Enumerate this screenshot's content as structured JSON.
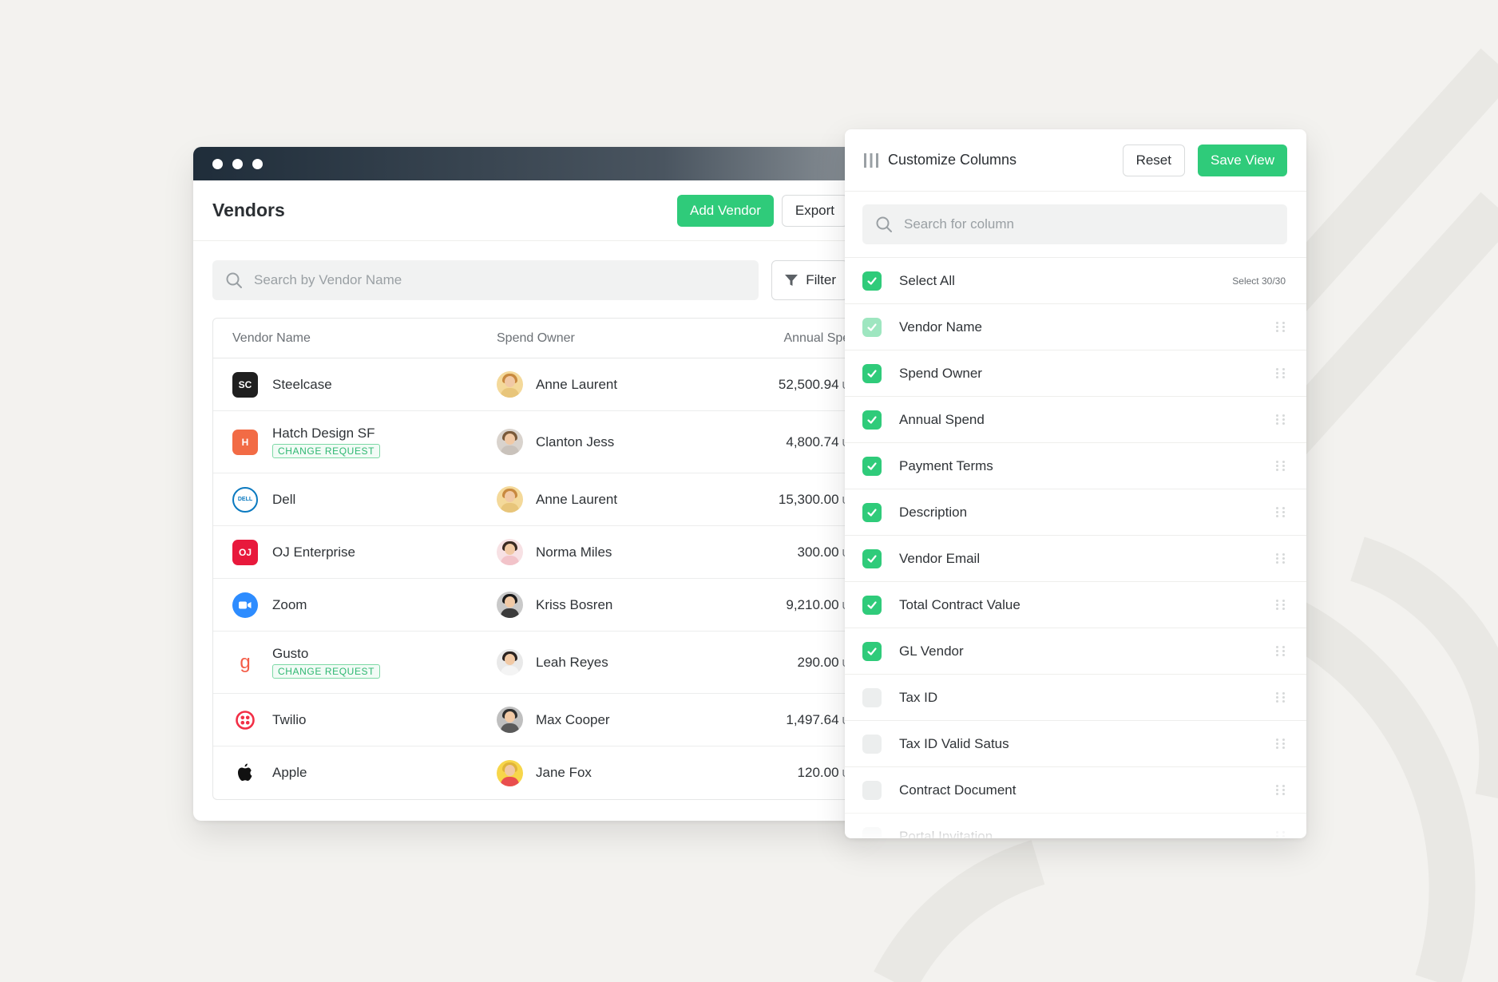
{
  "window": {
    "title": "Vendors",
    "add_vendor_label": "Add Vendor",
    "export_label": "Export",
    "search_placeholder": "Search by Vendor Name",
    "filter_label": "Filter"
  },
  "table": {
    "columns": [
      "Vendor Name",
      "Spend Owner",
      "Annual Spend"
    ],
    "rows": [
      {
        "vendor": "Steelcase",
        "logo_text": "SC",
        "logo_color": "#1f1f1f",
        "badge": "",
        "owner": "Anne Laurent",
        "amount": "52,500.94",
        "currency": "USD"
      },
      {
        "vendor": "Hatch Design SF",
        "logo_text": "H",
        "logo_color": "#f26b45",
        "badge": "CHANGE REQUEST",
        "owner": "Clanton Jess",
        "amount": "4,800.74",
        "currency": "USD"
      },
      {
        "vendor": "Dell",
        "logo_text": "DELL",
        "logo_color": "#0b7ac0",
        "badge": "",
        "owner": "Anne Laurent",
        "amount": "15,300.00",
        "currency": "USD"
      },
      {
        "vendor": "OJ Enterprise",
        "logo_text": "OJ",
        "logo_color": "#e8193c",
        "badge": "",
        "owner": "Norma Miles",
        "amount": "300.00",
        "currency": "USD"
      },
      {
        "vendor": "Zoom",
        "logo_text": "",
        "logo_color": "#2d8cff",
        "badge": "",
        "owner": "Kriss Bosren",
        "amount": "9,210.00",
        "currency": "USD"
      },
      {
        "vendor": "Gusto",
        "logo_text": "g",
        "logo_color": "#f45d48",
        "badge": "CHANGE REQUEST",
        "owner": "Leah Reyes",
        "amount": "290.00",
        "currency": "USD"
      },
      {
        "vendor": "Twilio",
        "logo_text": "",
        "logo_color": "#f22f46",
        "badge": "",
        "owner": "Max Cooper",
        "amount": "1,497.64",
        "currency": "USD"
      },
      {
        "vendor": "Apple",
        "logo_text": "",
        "logo_color": "#111111",
        "badge": "",
        "owner": "Jane Fox",
        "amount": "120.00",
        "currency": "USD"
      }
    ]
  },
  "panel": {
    "title": "Customize Columns",
    "reset_label": "Reset",
    "save_label": "Save View",
    "search_placeholder": "Search for column",
    "select_all_label": "Select All",
    "select_count": "Select 30/30",
    "columns": [
      {
        "label": "Vendor Name",
        "state": "light"
      },
      {
        "label": "Spend Owner",
        "state": "on"
      },
      {
        "label": "Annual Spend",
        "state": "on"
      },
      {
        "label": "Payment Terms",
        "state": "on"
      },
      {
        "label": "Description",
        "state": "on"
      },
      {
        "label": "Vendor Email",
        "state": "on"
      },
      {
        "label": "Total Contract Value",
        "state": "on"
      },
      {
        "label": "GL Vendor",
        "state": "on"
      },
      {
        "label": "Tax ID",
        "state": "off"
      },
      {
        "label": "Tax ID Valid Satus",
        "state": "off"
      },
      {
        "label": "Contract Document",
        "state": "off"
      },
      {
        "label": "Portal Invitation",
        "state": "off"
      }
    ]
  },
  "colors": {
    "accent_green": "#2fcb7a",
    "background": "#f3f2ef"
  }
}
